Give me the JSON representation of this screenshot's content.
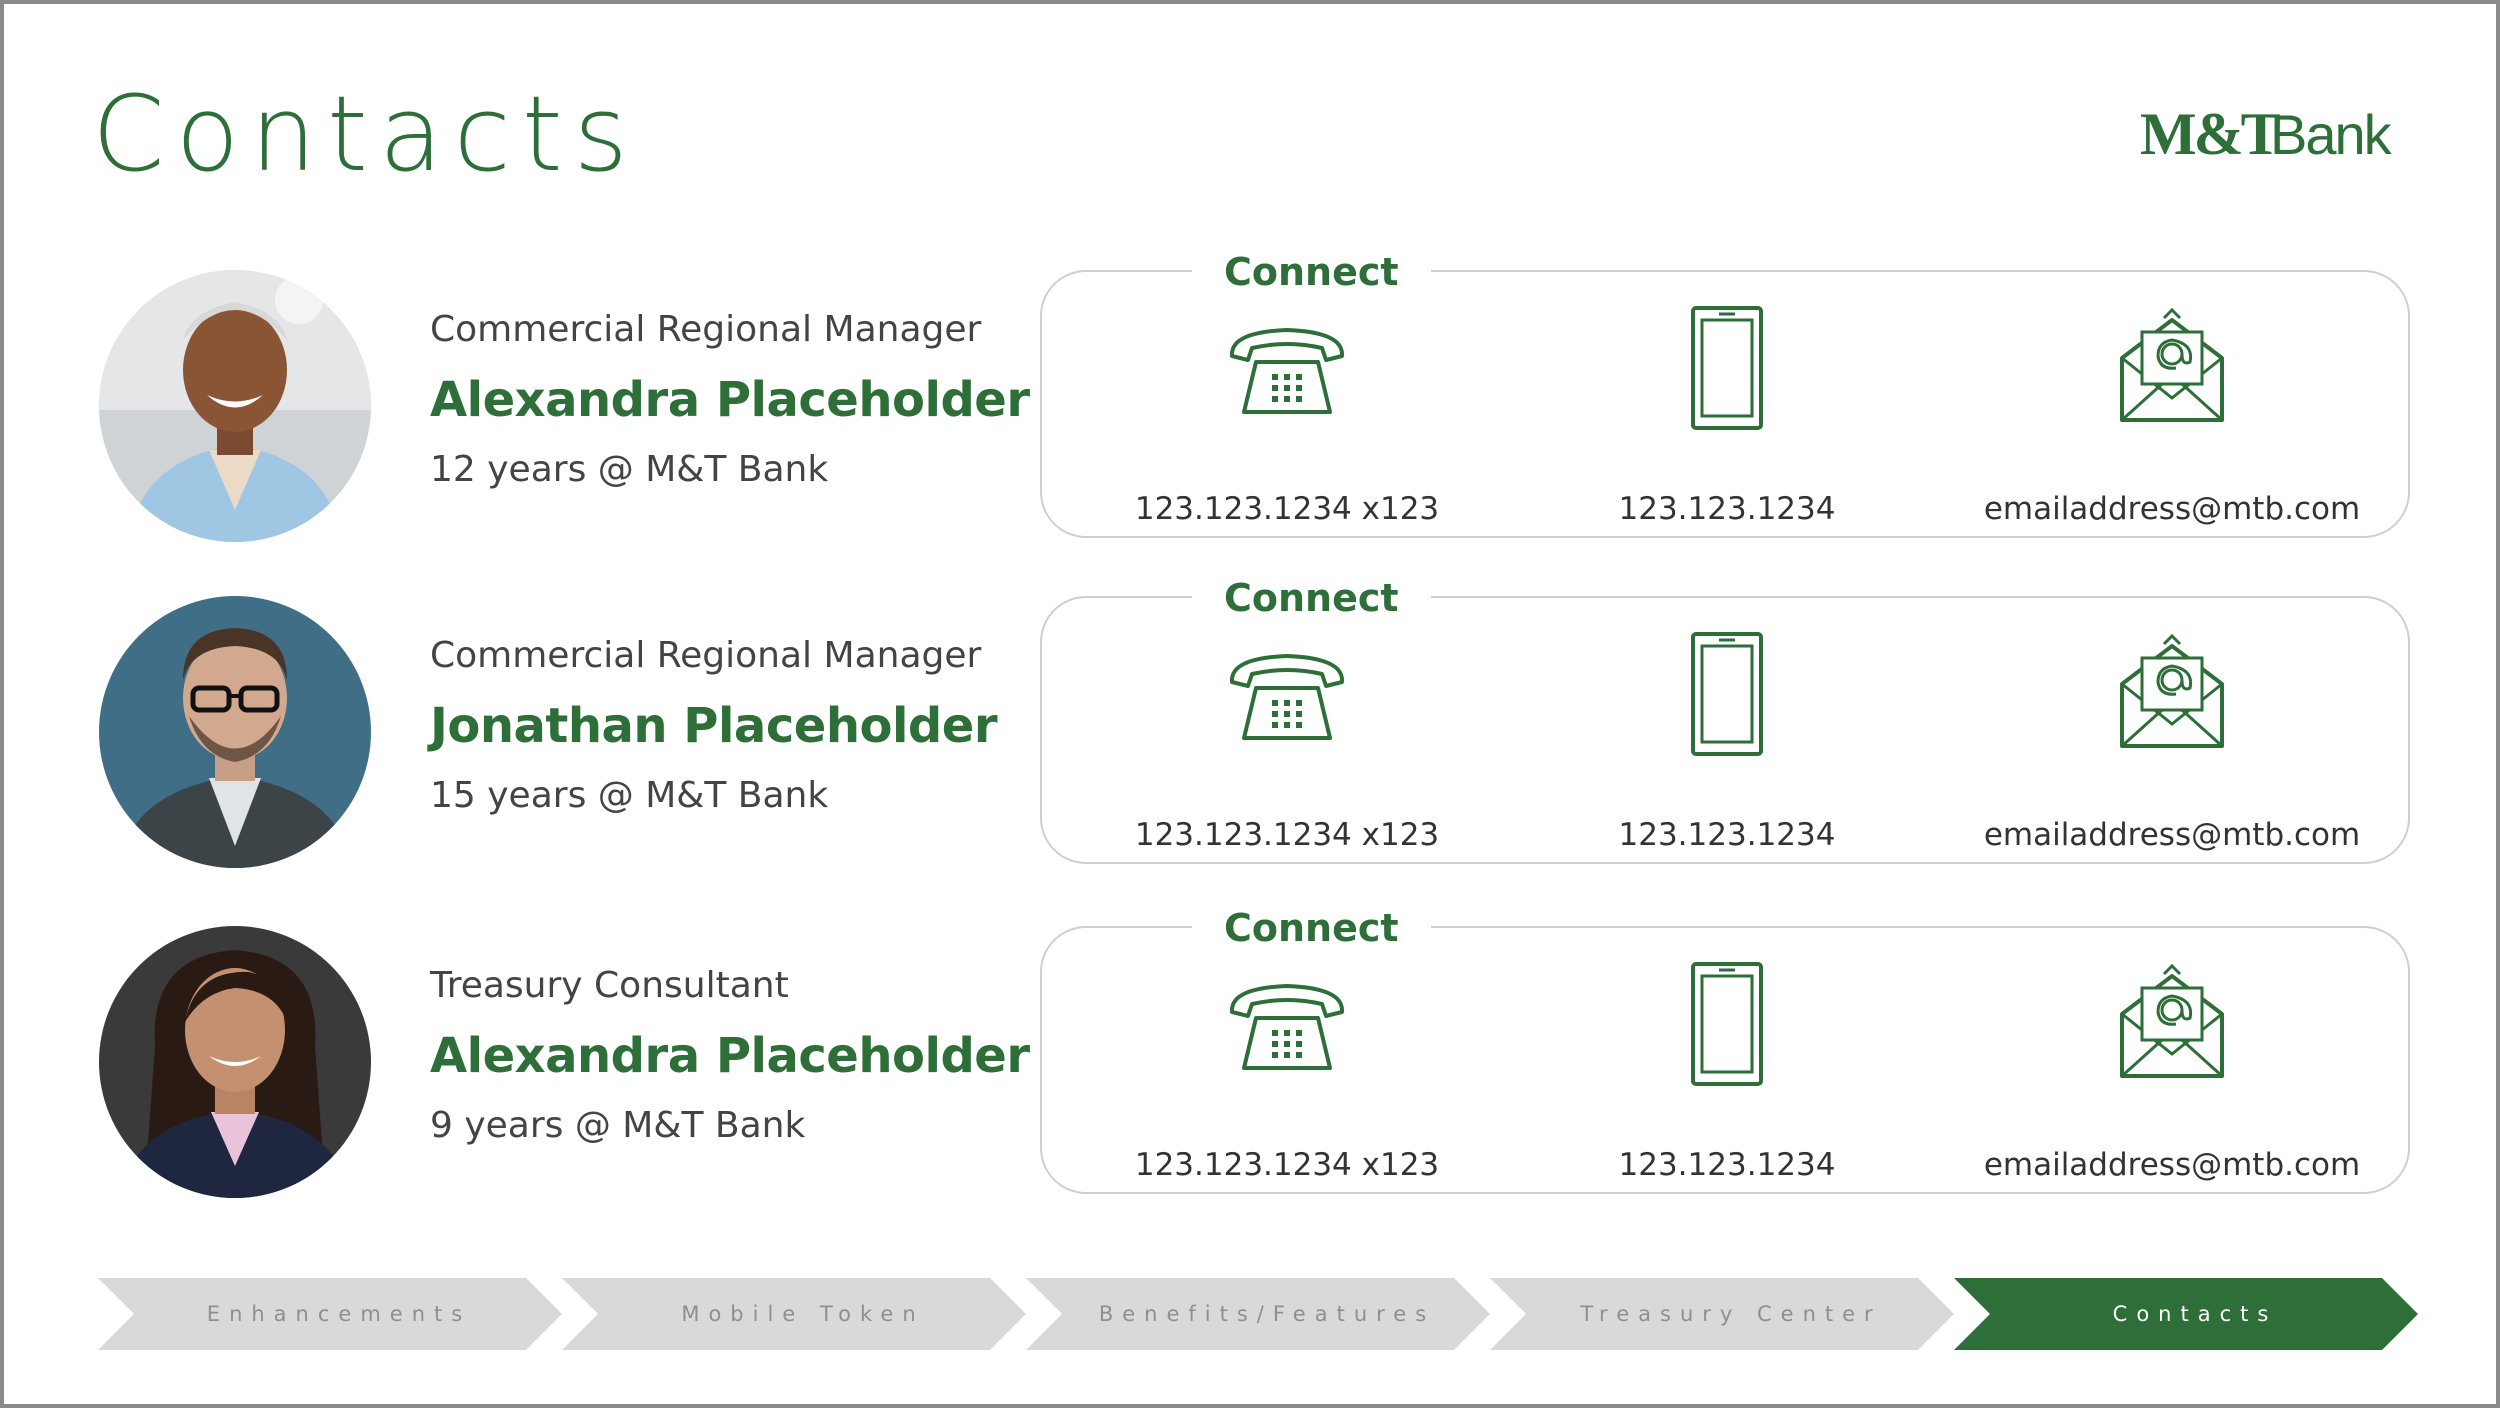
{
  "page": {
    "title": "Contacts"
  },
  "brand": {
    "logo_text": "M&T Bank",
    "color": "#2e6e39"
  },
  "colors": {
    "green": "#2e6e39",
    "nav_inactive": "#d9d9d9",
    "nav_active": "#2e6e39",
    "box_border": "#cfcfcf"
  },
  "contacts": [
    {
      "role": "Commercial Regional Manager",
      "name": "Alexandra Placeholder",
      "tenure": "12 years @ M&T Bank",
      "connect_label": "Connect",
      "phone": "123.123.1234 x123",
      "mobile": "123.123.1234",
      "email": "emailaddress@mtb.com",
      "icons": [
        "desk-phone-icon",
        "mobile-phone-icon",
        "email-envelope-icon"
      ]
    },
    {
      "role": "Commercial Regional Manager",
      "name": "Jonathan Placeholder",
      "tenure": "15 years @ M&T Bank",
      "connect_label": "Connect",
      "phone": "123.123.1234 x123",
      "mobile": "123.123.1234",
      "email": "emailaddress@mtb.com",
      "icons": [
        "desk-phone-icon",
        "mobile-phone-icon",
        "email-envelope-icon"
      ]
    },
    {
      "role": "Treasury Consultant",
      "name": "Alexandra Placeholder",
      "tenure": "9 years @ M&T Bank",
      "connect_label": "Connect",
      "phone": "123.123.1234 x123",
      "mobile": "123.123.1234",
      "email": "emailaddress@mtb.com",
      "icons": [
        "desk-phone-icon",
        "mobile-phone-icon",
        "email-envelope-icon"
      ]
    }
  ],
  "nav": {
    "steps": [
      {
        "label": "Enhancements",
        "active": false
      },
      {
        "label": "Mobile Token",
        "active": false
      },
      {
        "label": "Benefits/Features",
        "active": false
      },
      {
        "label": "Treasury Center",
        "active": false
      },
      {
        "label": "Contacts",
        "active": true
      }
    ]
  }
}
